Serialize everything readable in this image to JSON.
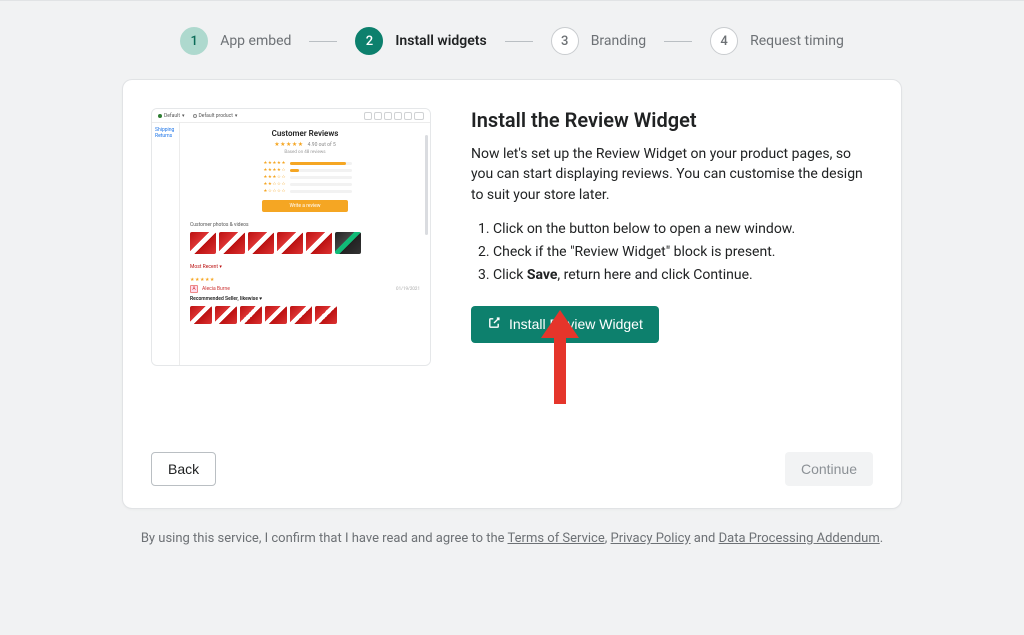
{
  "stepper": {
    "steps": [
      {
        "num": "1",
        "label": "App embed",
        "state": "done"
      },
      {
        "num": "2",
        "label": "Install widgets",
        "state": "current"
      },
      {
        "num": "3",
        "label": "Branding",
        "state": "pending"
      },
      {
        "num": "4",
        "label": "Request timing",
        "state": "pending"
      }
    ]
  },
  "instructions": {
    "heading": "Install the Review Widget",
    "body": "Now let's set up the Review Widget on your product pages, so you can start displaying reviews. You can customise the design to suit your store later.",
    "steps": [
      "Click on the button below to open a new window.",
      "Check if the \"Review Widget\" block is present."
    ],
    "step3_prefix": "Click ",
    "step3_bold": "Save",
    "step3_suffix": ", return here and click Continue."
  },
  "buttons": {
    "install": "Install Review Widget",
    "back": "Back",
    "continue": "Continue"
  },
  "legal": {
    "prefix": "By using this service, I confirm that I have read and agree to the ",
    "tos": "Terms of Service",
    "sep1": ", ",
    "privacy": "Privacy Policy",
    "and": " and ",
    "dpa": "Data Processing Addendum",
    "period": "."
  },
  "illustration": {
    "topbar_left_a": "Default",
    "topbar_left_b": "Default product",
    "side_label": "Shipping Returns",
    "title": "Customer Reviews",
    "subtitle": "Based on 48 reviews",
    "button_label": "Write a review",
    "photos_label": "Customer photos & videos",
    "sort_label": "Most Recent",
    "review_initial": "A",
    "review_name": "Alecia Burne",
    "review_date": "01/19/2021",
    "review_text": "Recommended Seller, likewise ♥"
  }
}
